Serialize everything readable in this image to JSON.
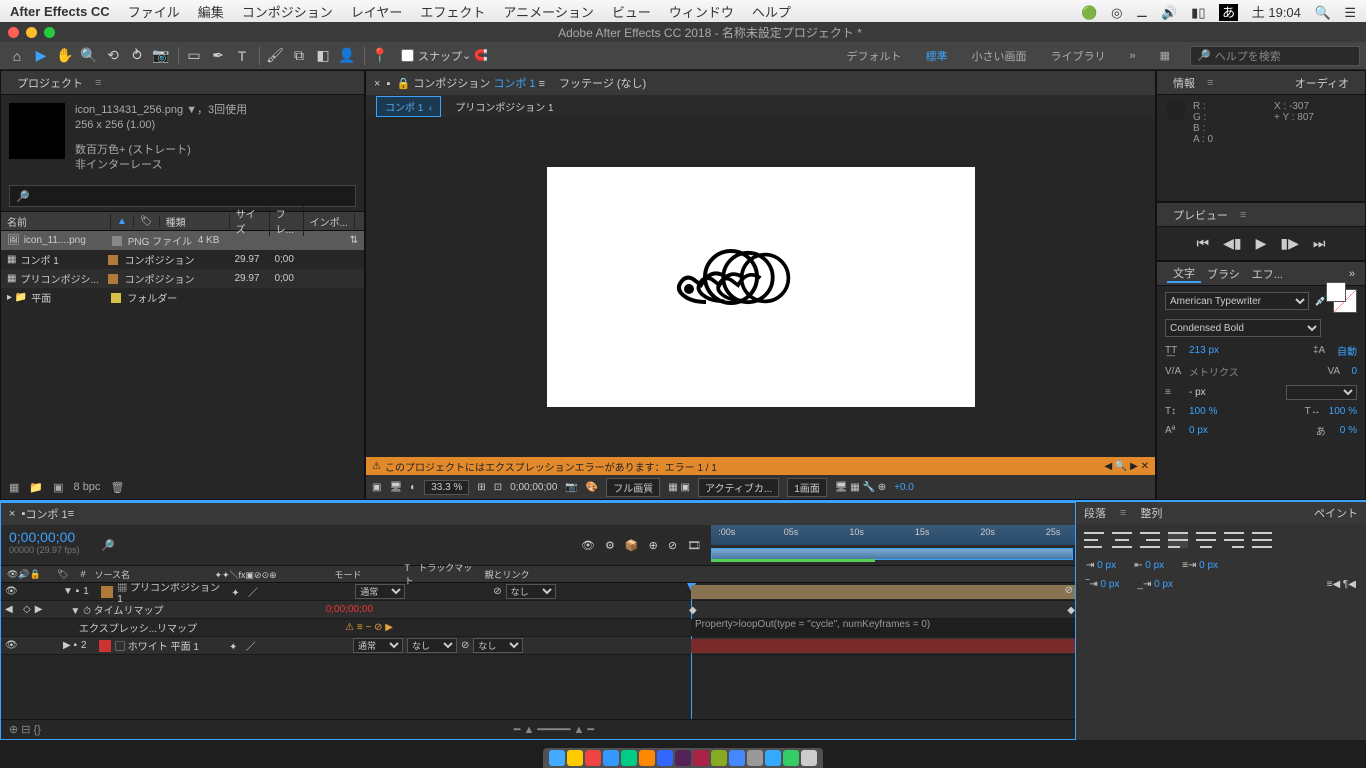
{
  "mac_menu": {
    "brand": "After Effects CC",
    "items": [
      "ファイル",
      "編集",
      "コンポジション",
      "レイヤー",
      "エフェクト",
      "アニメーション",
      "ビュー",
      "ウィンドウ",
      "ヘルプ"
    ],
    "clock": "土 19:04"
  },
  "window_title": "Adobe After Effects CC 2018 - 名称未設定プロジェクト *",
  "toolbar": {
    "snap": "スナップ",
    "ws": [
      "デフォルト",
      "標準",
      "小さい画面",
      "ライブラリ"
    ],
    "ws_active": 1,
    "search_ph": "ヘルプを検索"
  },
  "project": {
    "tab": "プロジェクト",
    "asset_name": "icon_113431_256.png",
    "asset_used": "▼，3回使用",
    "asset_dim": "256 x 256 (1.00)",
    "asset_color": "数百万色+ (ストレート)",
    "asset_interlace": "非インターレース",
    "cols": [
      "名前",
      "種類",
      "サイズ",
      "フレ...",
      "インポ..."
    ],
    "rows": [
      {
        "icon": "img",
        "name": "icon_11....png",
        "sw": "#888",
        "type": "PNG ファイル",
        "size": "4 KB",
        "fr": "",
        "sync": "⇅"
      },
      {
        "icon": "comp",
        "name": "コンポ 1",
        "sw": "#b07a3a",
        "type": "コンポジション",
        "size": "",
        "fr": "29.97",
        "in": "0;00"
      },
      {
        "icon": "comp",
        "name": "プリコンポジシ...",
        "sw": "#b07a3a",
        "type": "コンポジション",
        "size": "",
        "fr": "29.97",
        "in": "0;00"
      },
      {
        "icon": "folder",
        "name": "平面",
        "sw": "#d6c24a",
        "type": "フォルダー",
        "size": "",
        "fr": "",
        "in": ""
      }
    ],
    "bpc": "8 bpc"
  },
  "comp": {
    "tabs_left_prefix": "コンポジション",
    "tabs_left_name": "コンポ 1",
    "tabs_right": "フッテージ (なし)",
    "bc": [
      "コンポ 1",
      "プリコンポジション 1"
    ],
    "bc_active": 0,
    "warn": "このプロジェクトにはエクスプレッションエラーがあります：エラー 1 / 1",
    "zoom": "33.3 %",
    "time": "0;00;00;00",
    "res": "フル画質",
    "cam": "アクティブカ...",
    "views": "1画面",
    "exp": "+0.0"
  },
  "right": {
    "info_tab": "情報",
    "audio_tab": "オーディオ",
    "info": {
      "R": "R :",
      "G": "G :",
      "B": "B :",
      "A": "A :  0",
      "X": "X : -307",
      "Y": "Y :  807"
    },
    "preview_tab": "プレビュー",
    "char_tab": "文字",
    "brush_tab": "ブラシ",
    "fx_tab": "エフ...",
    "font": "American Typewriter",
    "weight": "Condensed Bold",
    "size_lbl": "T͟T",
    "size": "213 px",
    "lead_lbl": "‡A",
    "lead": "自動",
    "track_lbl": "V/A",
    "track": "メトリクス",
    "kern_lbl": "VA",
    "kern": "0",
    "stroke": "- px",
    "fill": "",
    "vsc": "T↕",
    "vsc_v": "100 %",
    "hsc": "T↔",
    "hsc_v": "100 %",
    "bl": "Aª",
    "bl_v": "0 px",
    "tsume": "あ",
    "tsume_v": "0 %"
  },
  "timeline": {
    "tab": "コンポ 1",
    "cur": "0;00;00;00",
    "fps": "00000 (29.97 fps)",
    "head_left": [
      "#",
      "ソース名"
    ],
    "head_mid": [
      "モード",
      "トラックマット",
      "親とリンク"
    ],
    "ruler": [
      ":00s",
      "05s",
      "10s",
      "15s",
      "20s",
      "25s"
    ],
    "rows": [
      {
        "num": "1",
        "sw": "#b07a3a",
        "name": "プリコンポジション 1",
        "mode": "通常",
        "mat": "",
        "parent": "なし"
      },
      {
        "prop": "タイムリマップ",
        "val": "0;00;00;00"
      },
      {
        "prop": "エクスプレッシ...リマップ",
        "expr": "Property>loopOut(type = \"cycle\", numKeyframes = 0)"
      },
      {
        "num": "2",
        "sw": "#c33",
        "name": "ホワイト 平面 1",
        "mode": "通常",
        "mat": "なし",
        "parent": "なし"
      }
    ]
  },
  "para": {
    "tabs": [
      "段落",
      "整列",
      "ペイント"
    ],
    "indents": [
      "0 px",
      "0 px",
      "0 px",
      "0 px",
      "0 px"
    ]
  }
}
